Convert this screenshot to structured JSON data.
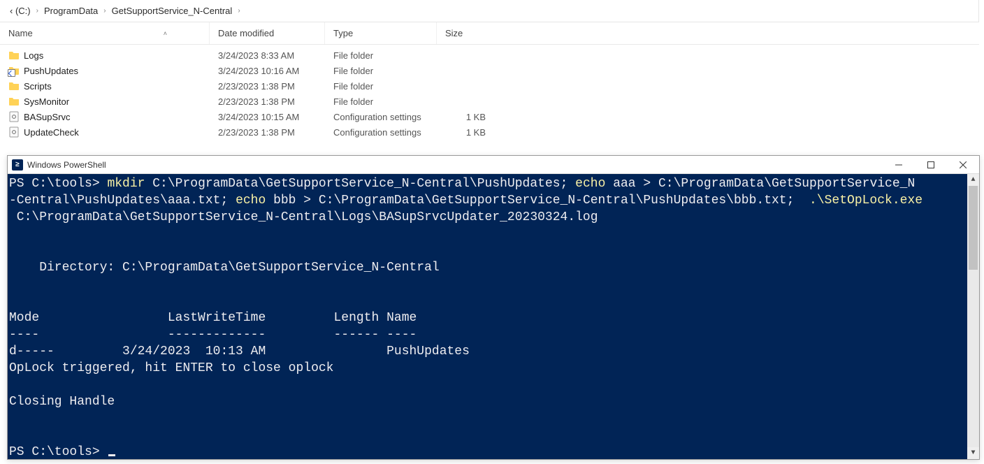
{
  "explorer": {
    "breadcrumb": {
      "seg1": "‹ (C:)",
      "seg2": "ProgramData",
      "seg3": "GetSupportService_N-Central"
    },
    "headers": {
      "name": "Name",
      "date": "Date modified",
      "type": "Type",
      "size": "Size"
    },
    "rows": [
      {
        "icon": "folder",
        "name": "Logs",
        "date": "3/24/2023 8:33 AM",
        "type": "File folder",
        "size": ""
      },
      {
        "icon": "shortcut",
        "name": "PushUpdates",
        "date": "3/24/2023 10:16 AM",
        "type": "File folder",
        "size": ""
      },
      {
        "icon": "folder",
        "name": "Scripts",
        "date": "2/23/2023 1:38 PM",
        "type": "File folder",
        "size": ""
      },
      {
        "icon": "folder",
        "name": "SysMonitor",
        "date": "2/23/2023 1:38 PM",
        "type": "File folder",
        "size": ""
      },
      {
        "icon": "config",
        "name": "BASupSrvc",
        "date": "3/24/2023 10:15 AM",
        "type": "Configuration settings",
        "size": "1 KB"
      },
      {
        "icon": "config",
        "name": "UpdateCheck",
        "date": "2/23/2023 1:38 PM",
        "type": "Configuration settings",
        "size": "1 KB"
      }
    ]
  },
  "powershell": {
    "title": "Windows PowerShell",
    "icon_glyph": "≥",
    "cmd": {
      "prompt1": "PS C:\\tools> ",
      "mkdir": "mkdir",
      "mkdir_arg": " C:\\ProgramData\\GetSupportService_N-Central\\PushUpdates",
      "sep1": "; ",
      "echo1": "echo",
      "echo1_arg": " aaa > C:\\ProgramData\\GetSupportService_N",
      "line2_pre": "-Central\\PushUpdates\\aaa.txt",
      "sep2": "; ",
      "echo2": "echo",
      "echo2_arg": " bbb > C:\\ProgramData\\GetSupportService_N-Central\\PushUpdates\\bbb.txt",
      "sep3": ";  ",
      "setop": ".\\SetOpLock.exe",
      "line3": " C:\\ProgramData\\GetSupportService_N-Central\\Logs\\BASupSrvcUpdater_20230324.log"
    },
    "out": {
      "blank": "",
      "dir_label": "    Directory: C:\\ProgramData\\GetSupportService_N-Central",
      "hdr": "Mode                 LastWriteTime         Length Name",
      "sep": "----                 -------------         ------ ----",
      "row": "d-----         3/24/2023  10:13 AM                PushUpdates",
      "oplock": "OpLock triggered, hit ENTER to close oplock",
      "closing": "Closing Handle",
      "prompt2": "PS C:\\tools> "
    }
  }
}
